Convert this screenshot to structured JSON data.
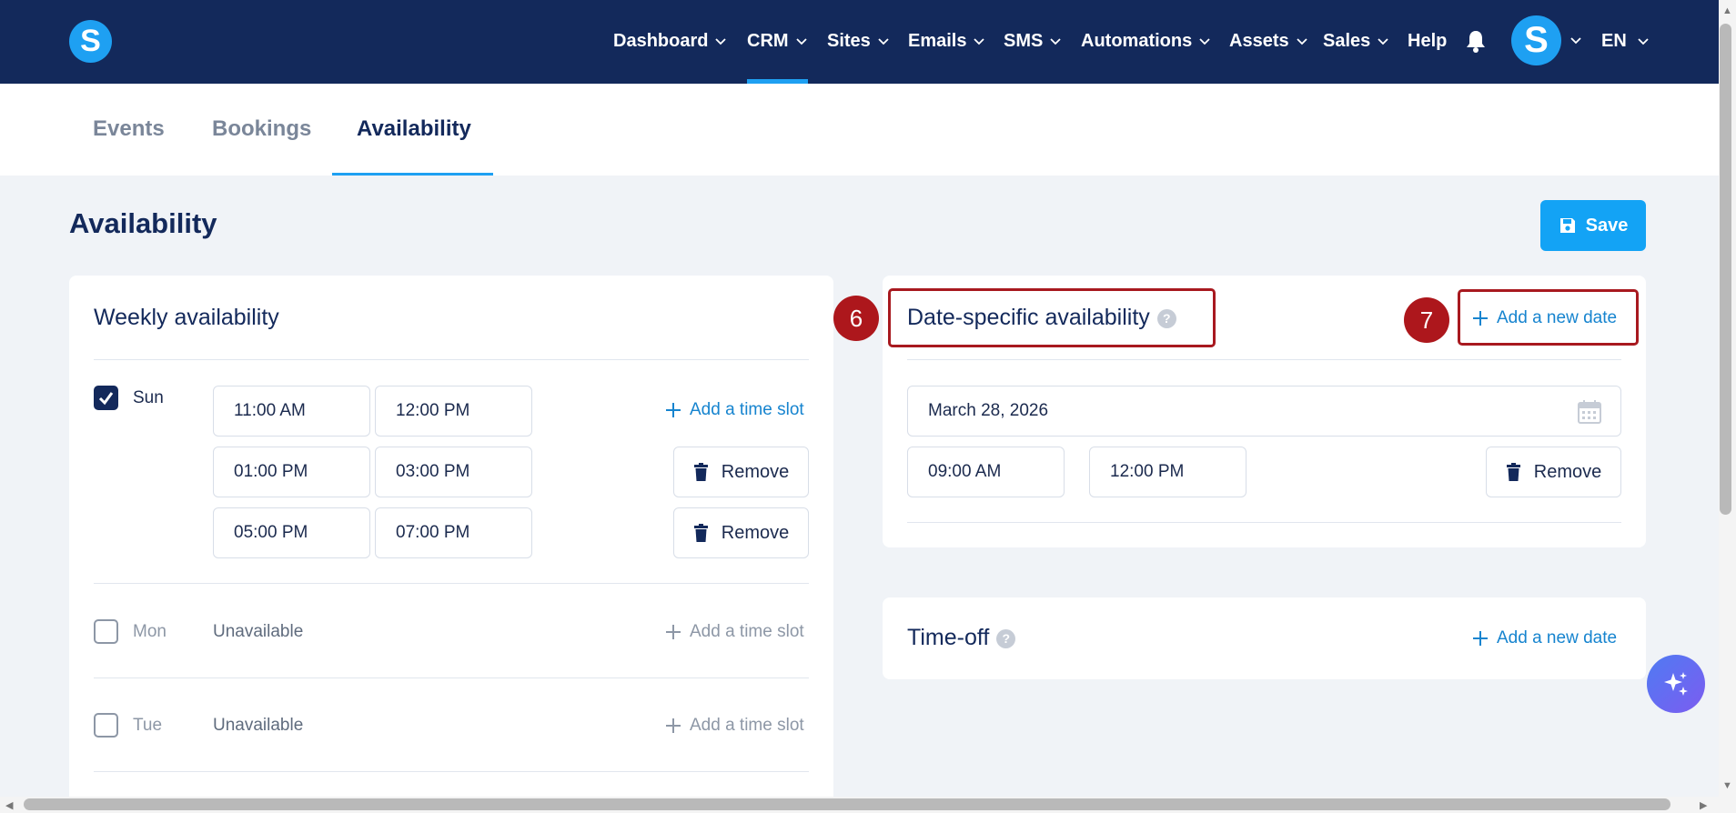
{
  "nav": {
    "logo_letter": "S",
    "items": [
      {
        "label": "Dashboard"
      },
      {
        "label": "CRM"
      },
      {
        "label": "Sites"
      },
      {
        "label": "Emails"
      },
      {
        "label": "SMS"
      },
      {
        "label": "Automations"
      },
      {
        "label": "Assets"
      },
      {
        "label": "Sales"
      },
      {
        "label": "Help"
      }
    ],
    "active_item": "CRM",
    "avatar_letter": "S",
    "language": "EN"
  },
  "subtabs": [
    {
      "label": "Events"
    },
    {
      "label": "Bookings"
    },
    {
      "label": "Availability"
    }
  ],
  "active_subtab": "Availability",
  "page": {
    "title": "Availability",
    "save_label": "Save"
  },
  "weekly": {
    "title": "Weekly availability",
    "add_slot_label": "Add a time slot",
    "remove_label": "Remove",
    "unavailable_label": "Unavailable",
    "days": [
      {
        "name": "Sun",
        "checked": true,
        "slots": [
          {
            "start": "11:00 AM",
            "end": "12:00 PM"
          },
          {
            "start": "01:00 PM",
            "end": "03:00 PM"
          },
          {
            "start": "05:00 PM",
            "end": "07:00 PM"
          }
        ]
      },
      {
        "name": "Mon",
        "checked": false
      },
      {
        "name": "Tue",
        "checked": false
      }
    ]
  },
  "date_specific": {
    "title": "Date-specific availability",
    "add_date_label": "Add a new date",
    "date_value": "March 28, 2026",
    "slot_start": "09:00 AM",
    "slot_end": "12:00 PM",
    "remove_label": "Remove"
  },
  "time_off": {
    "title": "Time-off",
    "add_date_label": "Add a new date"
  },
  "annotations": [
    {
      "number": "6"
    },
    {
      "number": "7"
    }
  ],
  "colors": {
    "navbar": "#13295b",
    "accent": "#1ea0f2",
    "annotation": "#ad171c",
    "link": "#1684cf"
  }
}
